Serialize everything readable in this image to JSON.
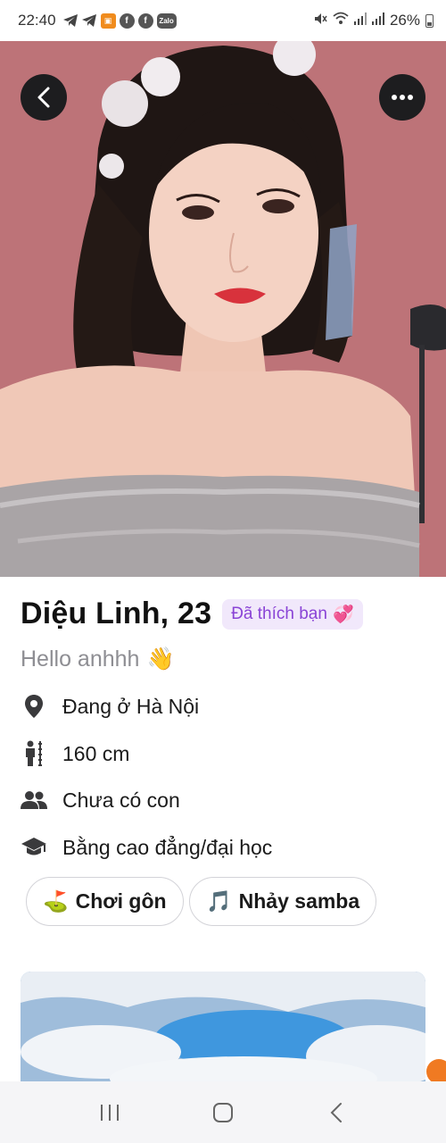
{
  "status_bar": {
    "time": "22:40",
    "battery": "26%",
    "left_icons": [
      "telegram-icon",
      "telegram-icon",
      "shop-icon",
      "facebook-icon",
      "facebook-icon",
      "zalo-icon"
    ],
    "zalo_label": "Zalo",
    "right_icons": [
      "mute-icon",
      "wifi-icon",
      "signal-icon",
      "signal-icon",
      "battery-icon"
    ]
  },
  "photo": {
    "description_icon": "profile-photo",
    "back_icon": "chevron-left-icon",
    "more_icon": "more-dots-icon"
  },
  "profile": {
    "name_age": "Diệu Linh, 23",
    "liked_badge": "Đã thích bạn",
    "liked_emoji": "💞",
    "bio": "Hello anhhh",
    "bio_emoji": "👋",
    "details": [
      {
        "icon": "location-pin-icon",
        "text": "Đang ở Hà Nội"
      },
      {
        "icon": "height-icon",
        "text": "160 cm"
      },
      {
        "icon": "people-icon",
        "text": "Chưa có con"
      },
      {
        "icon": "graduation-cap-icon",
        "text": "Bằng cao đẳng/đại học"
      }
    ],
    "interests": [
      {
        "emoji": "⛳",
        "label": "Chơi gôn"
      },
      {
        "emoji": "🎵",
        "label": "Nhảy samba"
      }
    ]
  },
  "colors": {
    "badge_bg": "#f1e8fb",
    "badge_text": "#8a44d6",
    "accent_orange": "#f07a22"
  },
  "nav_bar": {
    "icons": [
      "recent-apps-icon",
      "home-icon",
      "back-icon"
    ]
  }
}
